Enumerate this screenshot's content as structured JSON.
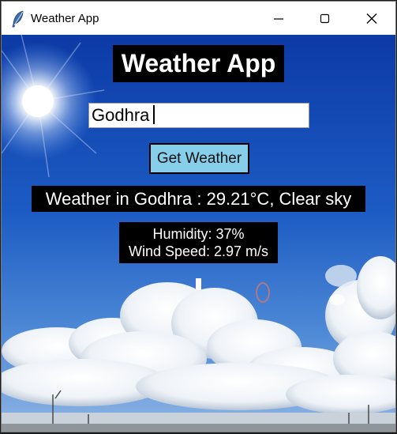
{
  "window": {
    "title": "Weather App",
    "icon": "feather-icon",
    "controls": [
      "minimize-icon",
      "maximize-icon",
      "close-icon"
    ]
  },
  "app": {
    "heading": "Weather App",
    "city_input_value": "Godhra",
    "get_button_label": "Get Weather",
    "weather_text": "Weather in Godhra : 29.21°C, Clear sky",
    "humidity_text": "Humidity: 37%",
    "wind_text": "Wind Speed: 2.97 m/s"
  },
  "colors": {
    "button_bg": "#87ceeb",
    "label_bg": "#000000",
    "label_fg": "#ffffff"
  }
}
